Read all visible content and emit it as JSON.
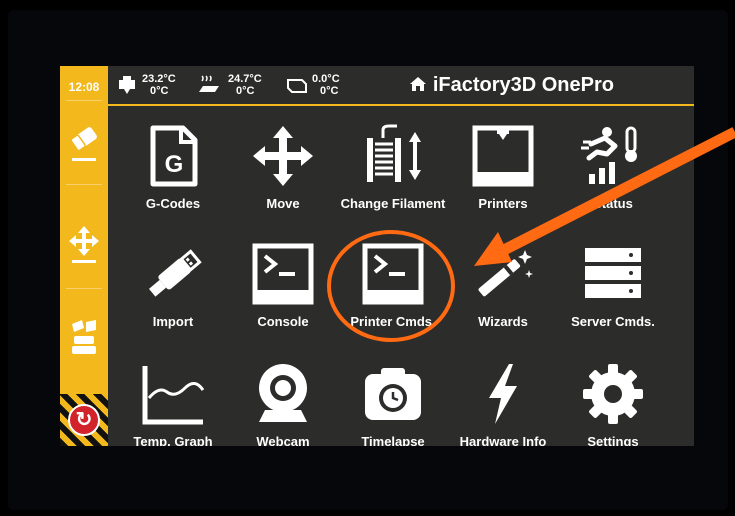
{
  "status": {
    "time": "12:08"
  },
  "temps": [
    {
      "icon": "extruder-icon",
      "current": "23.2°C",
      "target": "0°C"
    },
    {
      "icon": "heated-bed-icon",
      "current": "24.7°C",
      "target": "0°C"
    },
    {
      "icon": "chamber-icon",
      "current": "0.0°C",
      "target": "0°C"
    }
  ],
  "header": {
    "title": "iFactory3D OnePro",
    "icon": "home-icon"
  },
  "sidebar": {
    "items": [
      {
        "icon": "eraser-icon"
      },
      {
        "icon": "move-arrows-icon"
      },
      {
        "icon": "extrude-icon"
      },
      {
        "icon": "emergency-stop-icon"
      }
    ]
  },
  "grid": {
    "items": [
      {
        "label": "G-Codes",
        "icon": "gcode-file-icon"
      },
      {
        "label": "Move",
        "icon": "move-arrows-icon"
      },
      {
        "label": "Change Filament",
        "icon": "filament-spool-icon"
      },
      {
        "label": "Printers",
        "icon": "printer-icon"
      },
      {
        "label": "Status",
        "icon": "status-icon"
      },
      {
        "label": "Import",
        "icon": "usb-icon"
      },
      {
        "label": "Console",
        "icon": "console-icon"
      },
      {
        "label": "Printer Cmds.",
        "icon": "printer-console-icon"
      },
      {
        "label": "Wizards",
        "icon": "wand-icon"
      },
      {
        "label": "Server Cmds.",
        "icon": "server-icon"
      },
      {
        "label": "Temp. Graph",
        "icon": "temperature-graph-icon"
      },
      {
        "label": "Webcam",
        "icon": "webcam-icon"
      },
      {
        "label": "Timelapse",
        "icon": "timelapse-camera-icon"
      },
      {
        "label": "Hardware Info",
        "icon": "lightning-icon"
      },
      {
        "label": "Settings",
        "icon": "gear-icon"
      }
    ]
  },
  "annotation": {
    "color": "#ff6a13"
  }
}
